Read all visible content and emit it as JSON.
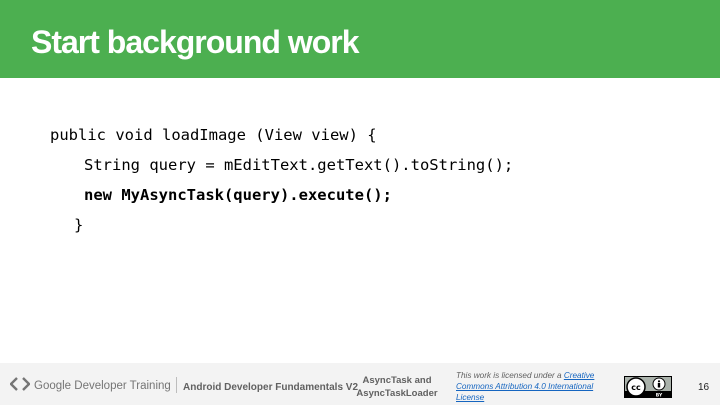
{
  "header": {
    "title": "Start background work",
    "color": "#4caf50"
  },
  "code": {
    "line1": "public void loadImage (View view) {",
    "line2": "String query = mEditText.getText().toString();",
    "line3": "new MyAsyncTask(query).execute();",
    "line4": "}"
  },
  "footer": {
    "brand_icon": "chevron-code-icon",
    "brand_label": "Google Developer Training",
    "course": "Android Developer Fundamentals V2",
    "topic_line1": "AsyncTask and",
    "topic_line2": "AsyncTaskLoader",
    "license_prefix": "This work is licensed under a ",
    "license_link": "Creative Commons Attribution 4.0 International License",
    "license_badge_icon": "cc-by-icon",
    "page_number": "16"
  }
}
